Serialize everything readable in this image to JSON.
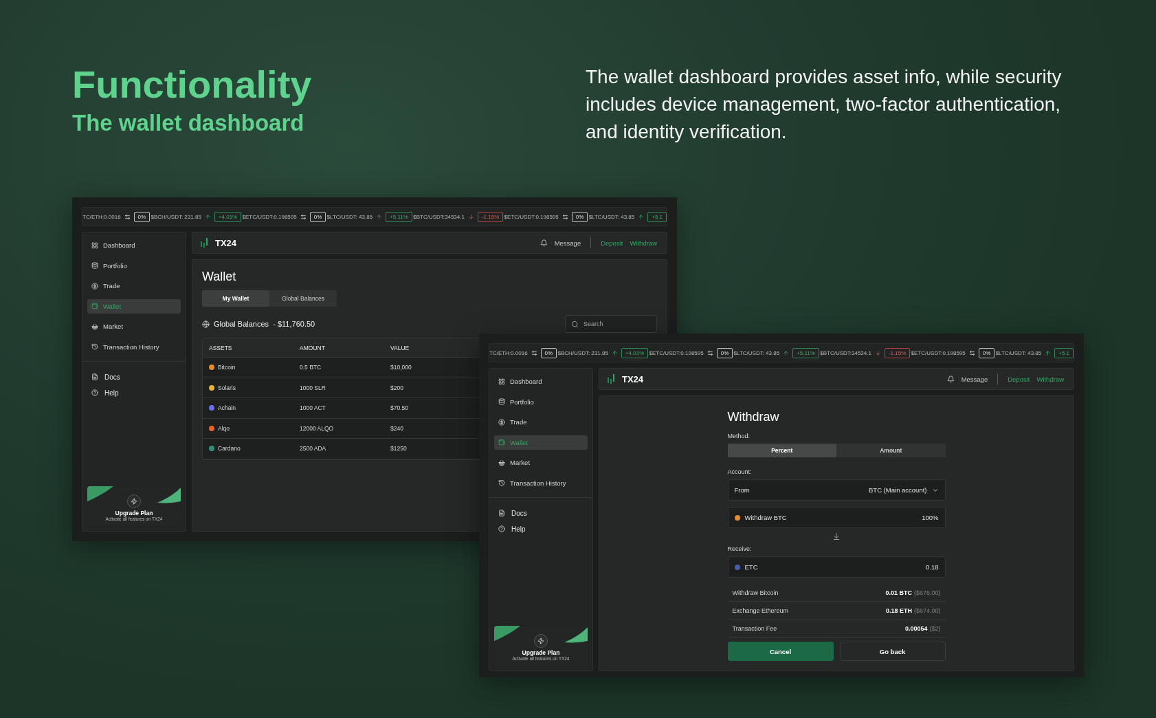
{
  "hero": {
    "title": "Functionality",
    "subtitle": "The wallet dashboard",
    "description": "The wallet dashboard provides asset info, while security includes device management, two-factor authentication, and identity verification."
  },
  "left_window": {
    "ticker": [
      {
        "pair": "TC/ETH:0.0016",
        "kind": "swap",
        "change": "0%"
      },
      {
        "pair": "$BCH/USDT: 231.85",
        "kind": "up",
        "change": "+4.01%"
      },
      {
        "pair": "$ETC/USDT:0.198595",
        "kind": "swap",
        "change": "0%"
      },
      {
        "pair": "$LTC/USDT: 43.85",
        "kind": "up",
        "change": "+5.11%"
      },
      {
        "pair": "$BTC/USDT:34534.1",
        "kind": "down",
        "change": "-1.15%"
      },
      {
        "pair": "$ETC/USDT:0.198595",
        "kind": "swap",
        "change": "0%"
      },
      {
        "pair": "$LTC/USDT: 43.85",
        "kind": "up",
        "change": "+5.1"
      }
    ],
    "sidebar": {
      "items": [
        {
          "label": "Dashboard",
          "selected": false
        },
        {
          "label": "Portfolio",
          "selected": false
        },
        {
          "label": "Trade",
          "selected": false
        },
        {
          "label": "Wallet",
          "selected": true
        },
        {
          "label": "Market",
          "selected": false
        },
        {
          "label": "Transaction History",
          "selected": false
        }
      ],
      "footer_items": [
        {
          "label": "Docs"
        },
        {
          "label": "Help"
        }
      ],
      "upgrade": {
        "title": "Upgrade Plan",
        "subtitle": "Activate all features on TX24"
      }
    },
    "header": {
      "brand": "TX24",
      "message": "Message",
      "links": [
        "Deposit",
        "Withdraw"
      ]
    },
    "wallet": {
      "title": "Wallet",
      "tabs": [
        {
          "label": "My Wallet",
          "selected": true
        },
        {
          "label": "Global Balances",
          "selected": false
        }
      ],
      "balance": "Global Balances  - $11,760.50",
      "search": {
        "placeholder": "Search"
      },
      "table": {
        "columns": [
          "ASSETS",
          "AMOUNT",
          "VALUE"
        ],
        "rows": [
          {
            "asset": "Bitcoin",
            "color": "#e8892a",
            "amount": "0.5 BTC",
            "value": "$10,000"
          },
          {
            "asset": "Solaris",
            "color": "#e6b432",
            "amount": "1000 SLR",
            "value": "$200"
          },
          {
            "asset": "Achain",
            "color": "#6a6ff0",
            "amount": "1000 ACT",
            "value": "$70.50"
          },
          {
            "asset": "Alqo",
            "color": "#e5632c",
            "amount": "12000  ALQO",
            "value": "$240"
          },
          {
            "asset": "Cardano",
            "color": "#2f8f7a",
            "amount": "2500 ADA",
            "value": "$1250"
          }
        ]
      }
    }
  },
  "right_window": {
    "ticker": [
      {
        "pair": "TC/ETH:0.0016",
        "kind": "swap",
        "change": "0%"
      },
      {
        "pair": "$BCH/USDT: 231.85",
        "kind": "up",
        "change": "+4.01%"
      },
      {
        "pair": "$ETC/USDT:0.198595",
        "kind": "swap",
        "change": "0%"
      },
      {
        "pair": "$LTC/USDT: 43.85",
        "kind": "up",
        "change": "+5.11%"
      },
      {
        "pair": "$BTC/USDT:34534.1",
        "kind": "down",
        "change": "-1.15%"
      },
      {
        "pair": "$ETC/USDT:0.198595",
        "kind": "swap",
        "change": "0%"
      },
      {
        "pair": "$LTC/USDT: 43.85",
        "kind": "up",
        "change": "+5.1"
      }
    ],
    "sidebar": {
      "items": [
        {
          "label": "Dashboard",
          "selected": false
        },
        {
          "label": "Portfolio",
          "selected": false
        },
        {
          "label": "Trade",
          "selected": false
        },
        {
          "label": "Wallet",
          "selected": true
        },
        {
          "label": "Market",
          "selected": false
        },
        {
          "label": "Transaction History",
          "selected": false
        }
      ],
      "footer_items": [
        {
          "label": "Docs"
        },
        {
          "label": "Help"
        }
      ],
      "upgrade": {
        "title": "Upgrade Plan",
        "subtitle": "Activate all features on TX24"
      }
    },
    "header": {
      "brand": "TX24",
      "message": "Message",
      "links": [
        "Deposit",
        "Withdraw"
      ]
    },
    "withdraw": {
      "title": "Withdraw",
      "method_label": "Method:",
      "methods": [
        {
          "label": "Percent",
          "selected": true
        },
        {
          "label": "Amount",
          "selected": false
        }
      ],
      "account_label": "Account:",
      "from": {
        "label": "From",
        "value": "BTC (Main account)"
      },
      "send": {
        "label": "Withdraw BTC",
        "color": "#e8892a",
        "value": "100%"
      },
      "receive_label": "Receive:",
      "receive": {
        "label": "ETC",
        "color": "#4a5bb0",
        "value": "0.18"
      },
      "summary": [
        {
          "label": "Withdraw Bitcoin",
          "value": "0.01 BTC",
          "usd": "($676.00)"
        },
        {
          "label": "Exchange Ethereum",
          "value": "0.18 ETH",
          "usd": "($674.00)"
        },
        {
          "label": "Transaction Fee",
          "value": "0.00054",
          "usd": "($2)"
        }
      ],
      "buttons": [
        {
          "label": "Cancel",
          "kind": "primary"
        },
        {
          "label": "Go back",
          "kind": "secondary"
        }
      ]
    }
  }
}
